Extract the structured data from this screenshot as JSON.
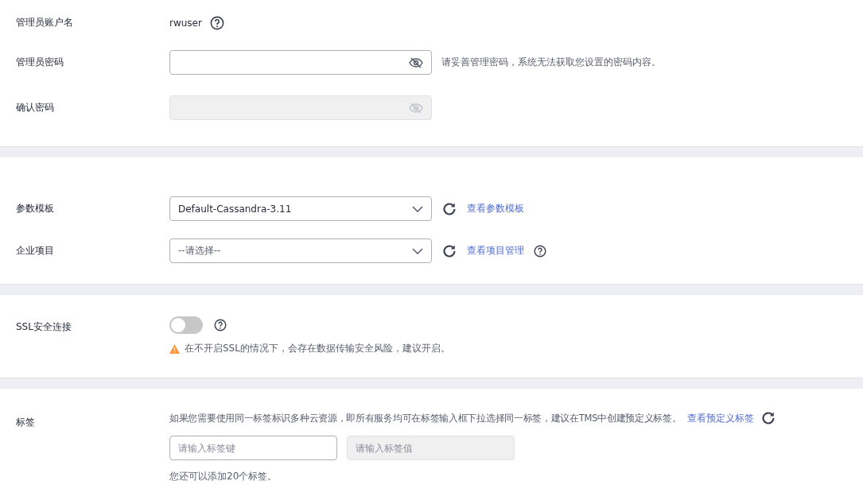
{
  "account": {
    "label": "管理员账户名",
    "value": "rwuser"
  },
  "password": {
    "label": "管理员密码",
    "hint": "请妥善管理密码，系统无法获取您设置的密码内容。",
    "disabled": false
  },
  "confirm": {
    "label": "确认密码",
    "disabled": true
  },
  "template": {
    "label": "参数模板",
    "value": "Default-Cassandra-3.11",
    "link": "查看参数模板"
  },
  "project": {
    "label": "企业项目",
    "placeholder": "--请选择--",
    "link": "查看项目管理"
  },
  "ssl": {
    "label": "SSL安全连接",
    "on": false,
    "warning": "在不开启SSL的情况下，会存在数据传输安全风险，建议开启。"
  },
  "tags": {
    "label": "标签",
    "note": "如果您需要使用同一标签标识多种云资源，即所有服务均可在标签输入框下拉选择同一标签，建议在TMS中创建预定义标签。",
    "link": "查看预定义标签",
    "key_placeholder": "请输入标签键",
    "value_placeholder": "请输入标签值",
    "value_disabled": true,
    "remaining": "您还可以添加20个标签。"
  }
}
